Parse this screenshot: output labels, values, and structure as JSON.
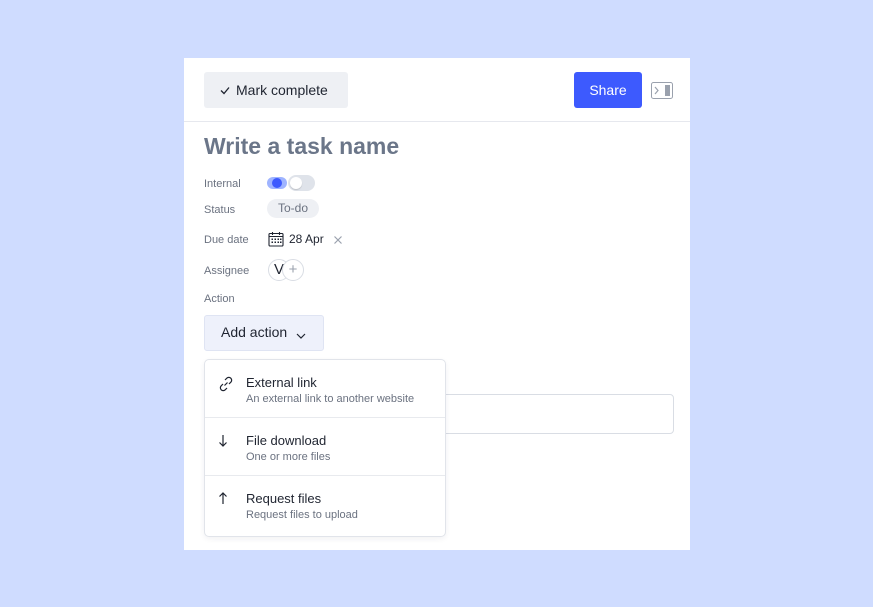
{
  "toolbar": {
    "mark_complete_label": "Mark complete",
    "share_label": "Share"
  },
  "task": {
    "title_placeholder": "Write a task name"
  },
  "fields": {
    "internal_label": "Internal",
    "internal_enabled": false,
    "status_label": "Status",
    "status_value": "To-do",
    "due_label": "Due date",
    "due_value": "28 Apr",
    "assignee_label": "Assignee",
    "assignee_initial": "V",
    "action_label": "Action"
  },
  "action": {
    "add_label": "Add action"
  },
  "dropdown": {
    "items": [
      {
        "icon": "link-icon",
        "title": "External link",
        "description": "An external link to another website"
      },
      {
        "icon": "arrow-down-icon",
        "title": "File download",
        "description": "One or more files"
      },
      {
        "icon": "arrow-up-icon",
        "title": "Request files",
        "description": "Request files to upload"
      }
    ]
  },
  "colors": {
    "page_background": "#cfdcff",
    "accent": "#3d5afe",
    "title_placeholder": "#6b7689"
  }
}
